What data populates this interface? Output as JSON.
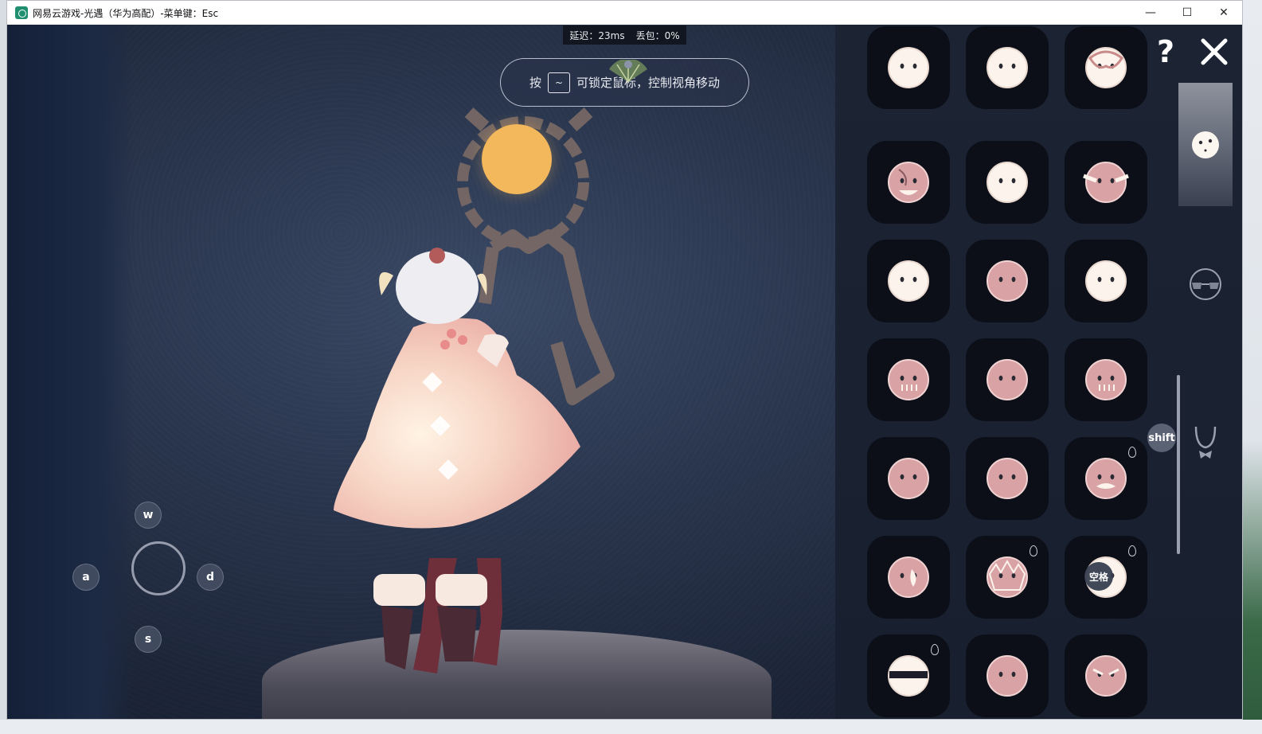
{
  "window": {
    "title": "网易云游戏-光遇（华为高配）-菜单键：Esc",
    "controls": {
      "minimize": "—",
      "maximize": "☐",
      "close": "✕"
    }
  },
  "hud": {
    "latency": "延迟：23ms",
    "packet_loss": "丢包：0%"
  },
  "hint": {
    "prefix": "按",
    "key": "~",
    "suffix": "可锁定鼠标，控制视角移动"
  },
  "movement_keys": {
    "w": "w",
    "a": "a",
    "s": "s",
    "d": "d"
  },
  "panel": {
    "help": "?",
    "shift_key": "shift",
    "space_key": "空格",
    "categories": [
      {
        "icon": "mask-icon",
        "active": true
      },
      {
        "icon": "glasses-icon",
        "active": false
      },
      {
        "icon": "necklace-icon",
        "active": false
      }
    ],
    "items": [
      {
        "icon": "mask-plain-icon"
      },
      {
        "icon": "mask-half-icon"
      },
      {
        "icon": "mask-ornate-icon"
      },
      {
        "icon": "mask-scar-icon"
      },
      {
        "icon": "mask-owl-icon"
      },
      {
        "icon": "mask-winged-icon"
      },
      {
        "icon": "mask-sleepy-icon"
      },
      {
        "icon": "mask-stripe-icon"
      },
      {
        "icon": "mask-flower-icon"
      },
      {
        "icon": "mask-tears-icon"
      },
      {
        "icon": "mask-closed-eyes-icon"
      },
      {
        "icon": "mask-lines-icon"
      },
      {
        "icon": "mask-sad-icon"
      },
      {
        "icon": "mask-freckles-icon"
      },
      {
        "icon": "mask-mustache-icon",
        "premium": true
      },
      {
        "icon": "mask-flame-icon"
      },
      {
        "icon": "mask-dragon-icon",
        "premium": true
      },
      {
        "icon": "mask-hood-icon",
        "premium": true
      },
      {
        "icon": "mask-bandana-icon",
        "premium": true
      },
      {
        "icon": "mask-petal-icon"
      },
      {
        "icon": "mask-grin-icon"
      }
    ]
  }
}
